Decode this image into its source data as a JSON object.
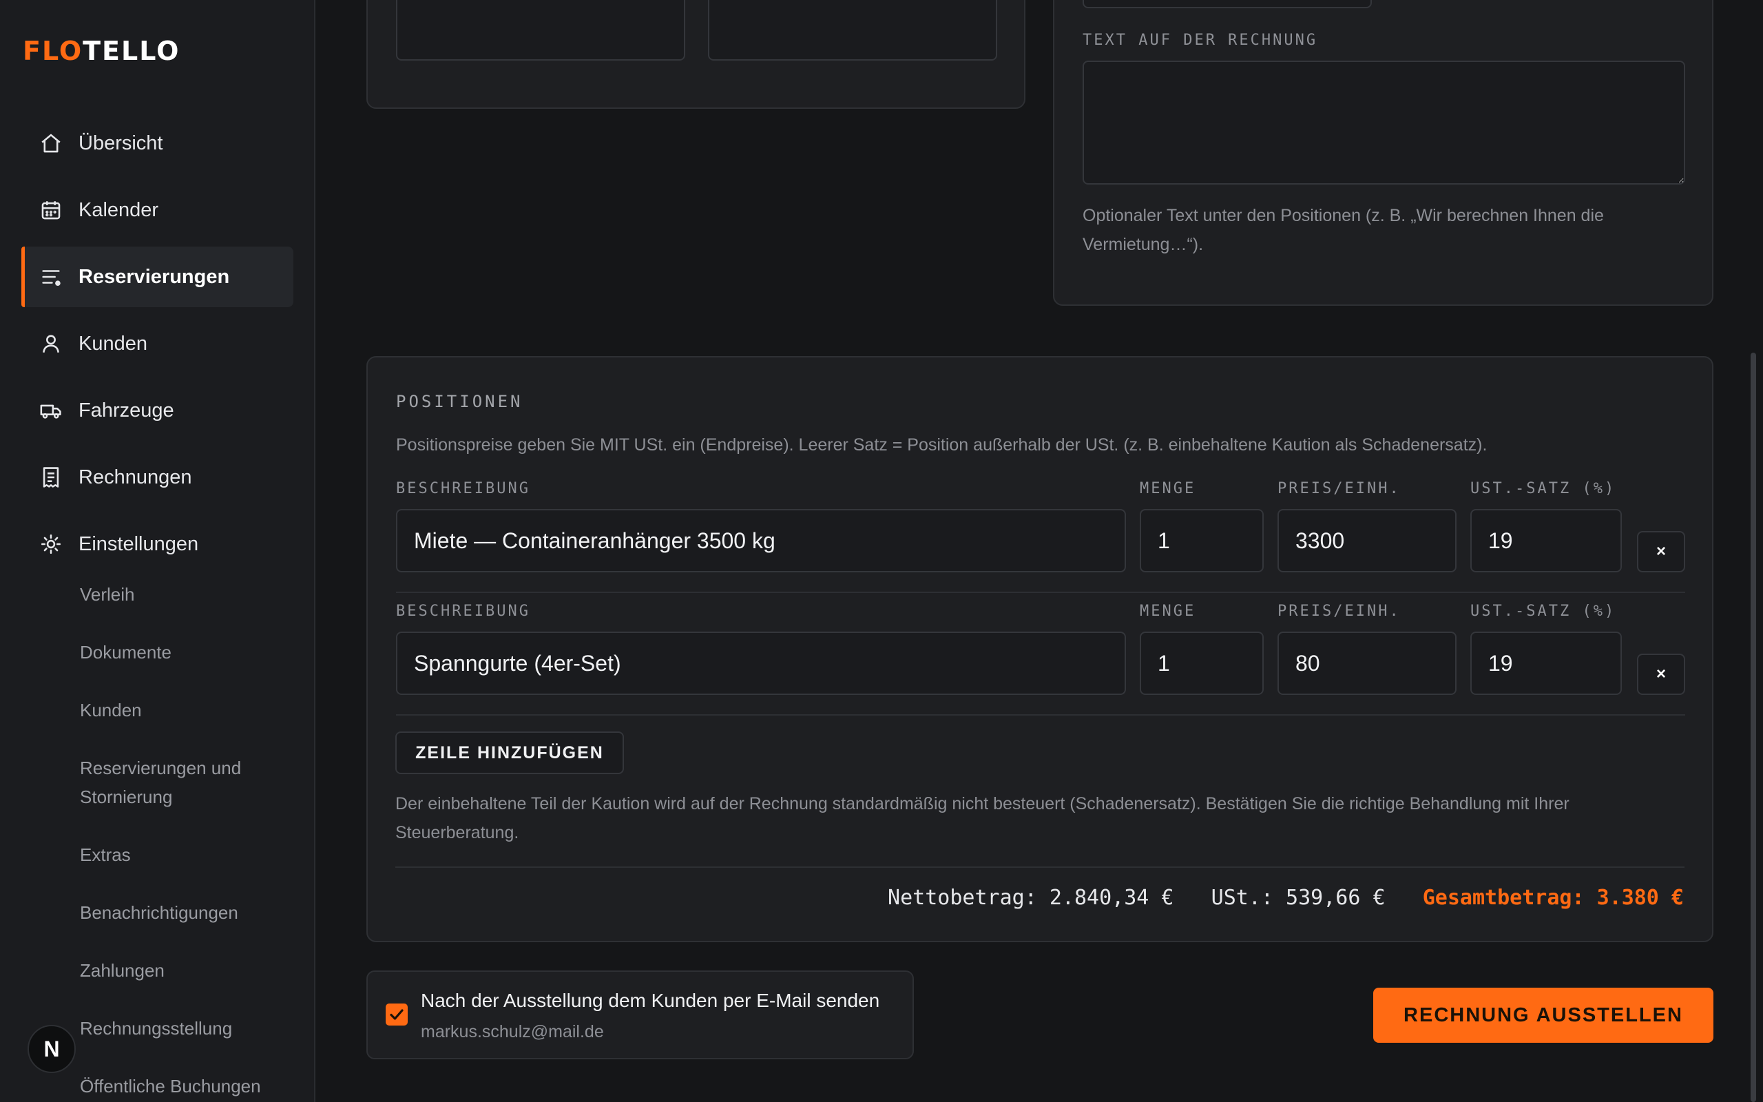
{
  "brand": {
    "part1": "FLO",
    "part2": "TELLO"
  },
  "nav": {
    "items": [
      {
        "label": "Übersicht",
        "icon": "home-icon"
      },
      {
        "label": "Kalender",
        "icon": "calendar-icon"
      },
      {
        "label": "Reservierungen",
        "icon": "list-icon",
        "active": true
      },
      {
        "label": "Kunden",
        "icon": "user-icon"
      },
      {
        "label": "Fahrzeuge",
        "icon": "truck-icon"
      },
      {
        "label": "Rechnungen",
        "icon": "receipt-icon"
      },
      {
        "label": "Einstellungen",
        "icon": "gear-icon"
      }
    ],
    "subitems": [
      "Verleih",
      "Dokumente",
      "Kunden",
      "Reservierungen und Stornierung",
      "Extras",
      "Benachrichtigungen",
      "Zahlungen",
      "Rechnungsstellung",
      "Öffentliche Buchungen"
    ]
  },
  "avatar": {
    "initial": "N"
  },
  "invoice_text": {
    "label": "TEXT AUF DER RECHNUNG",
    "value": "",
    "help": "Optionaler Text unter den Positionen (z. B. „Wir berechnen Ihnen die Vermietung…“)."
  },
  "positions": {
    "title": "POSITIONEN",
    "intro": "Positionspreise geben Sie MIT USt. ein (Endpreise). Leerer Satz = Position außerhalb der USt. (z. B. einbehaltene Kaution als Schadenersatz).",
    "columns": {
      "description": "BESCHREIBUNG",
      "quantity": "MENGE",
      "unit_price": "PREIS/EINH.",
      "vat_rate": "UST.-SATZ (%)"
    },
    "rows": [
      {
        "description": "Miete — Containeranhänger 3500 kg",
        "quantity": "1",
        "unit_price": "3300",
        "vat_rate": "19"
      },
      {
        "description": "Spanngurte (4er-Set)",
        "quantity": "1",
        "unit_price": "80",
        "vat_rate": "19"
      }
    ],
    "remove_label": "×",
    "add_row_label": "ZEILE HINZUFÜGEN",
    "deposit_note": "Der einbehaltene Teil der Kaution wird auf der Rechnung standardmäßig nicht besteuert (Schadenersatz). Bestätigen Sie die richtige Behandlung mit Ihrer Steuerberatung.",
    "totals": {
      "net": "Nettobetrag: 2.840,34 €",
      "vat": "USt.: 539,66 €",
      "gross": "Gesamtbetrag: 3.380 €"
    }
  },
  "send_email": {
    "checked": true,
    "label": "Nach der Ausstellung dem Kunden per E-Mail senden",
    "email": "markus.schulz@mail.de"
  },
  "issue_button": {
    "label": "RECHNUNG AUSSTELLEN"
  },
  "colors": {
    "accent": "#ff6a13",
    "background": "#151618",
    "card": "#1e1f22"
  }
}
